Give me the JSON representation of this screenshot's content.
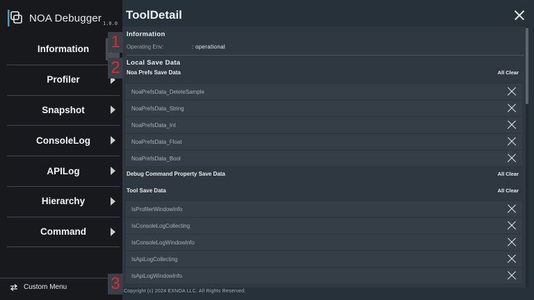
{
  "app": {
    "name": "NOA Debugger",
    "version": "1.0.0"
  },
  "sidebar": {
    "items": [
      {
        "label": "Information"
      },
      {
        "label": "Profiler"
      },
      {
        "label": "Snapshot"
      },
      {
        "label": "ConsoleLog"
      },
      {
        "label": "APILog"
      },
      {
        "label": "Hierarchy"
      },
      {
        "label": "Command"
      }
    ],
    "footer": {
      "label": "Custom Menu",
      "icon": "swap-arrows-icon"
    }
  },
  "panel": {
    "title": "ToolDetail",
    "close_icon": "close-icon",
    "information": {
      "heading": "Information",
      "env_label": "Operating Env:",
      "env_value": ": operational"
    },
    "local_save": {
      "heading": "Local Save Data",
      "groups": [
        {
          "title": "Noa Prefs Save Data",
          "clear_label": "All Clear",
          "items": [
            "NoaPrefsData_DeleteSample",
            "NoaPrefsData_String",
            "NoaPrefsData_Int",
            "NoaPrefsData_Float",
            "NoaPrefsData_Bool"
          ]
        },
        {
          "title": "Debug Command Property Save Data",
          "clear_label": "All Clear",
          "items": []
        },
        {
          "title": "Tool Save Data",
          "clear_label": "All Clear",
          "items": [
            "IsProfilerWindowInfo",
            "IsConsoleLogCollecting",
            "IsConsoleLogWindowInfo",
            "IsApiLogCollecting",
            "IsApiLogWindowInfo"
          ]
        }
      ]
    },
    "copyright": "Copyright (c) 2024 EXNOA LLC. All Rights Reserved."
  },
  "markers": [
    "1",
    "2",
    "3"
  ],
  "colors": {
    "marker": "#e0292f",
    "sidebar_bg": "#17191c",
    "panel_bg": "#27313a"
  }
}
